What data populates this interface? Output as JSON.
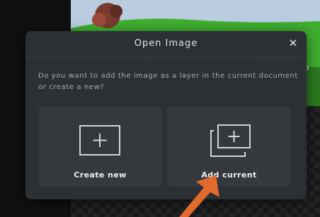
{
  "dialog": {
    "title": "Open Image",
    "close_label": "✕",
    "question": "Do you want to add the image as a layer in the current document or create a new?",
    "options": [
      {
        "label": "Create new",
        "icon": "plus-square-icon"
      },
      {
        "label": "Add current",
        "icon": "layers-plus-icon"
      }
    ]
  },
  "colors": {
    "dialog_bg": "#2c2f33",
    "option_bg": "#35383d",
    "annotation_arrow": "#e26a2c"
  }
}
